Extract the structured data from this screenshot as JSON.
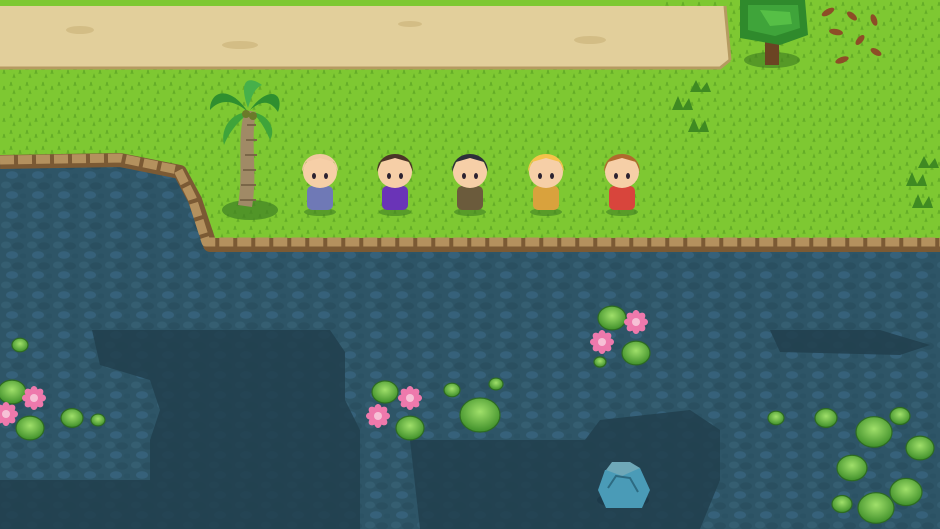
{
  "scene": {
    "type": "top-down-rpg-map",
    "terrain": [
      "dirt-path",
      "grass",
      "rocky-shoreline",
      "lake",
      "deep-water"
    ],
    "colors": {
      "grass": "#7ec832",
      "grass_dark": "#5fa526",
      "path": "#e2cf9b",
      "path_edge": "#b59a61",
      "water": "#2e5567",
      "deep_water": "#203e4d",
      "rock": "#b4915e",
      "rock_dark": "#7b5a34",
      "lily_pad": "#6fbf3b",
      "lotus": "#ee79ac"
    }
  },
  "party": [
    {
      "id": "elder",
      "role": "bald old man in blue robe",
      "hair": "#f1c9a1",
      "outfit": "#6f79b6"
    },
    {
      "id": "noble",
      "role": "bearded man in purple coat",
      "hair": "#4b3528",
      "outfit": "#6a34b7"
    },
    {
      "id": "rogue",
      "role": "dark-haired warrior with goggles",
      "hair": "#2d2f3a",
      "outfit": "#6b5b3c"
    },
    {
      "id": "priestess",
      "role": "blonde girl with white bandana",
      "hair": "#f5c34a",
      "outfit": "#d9a23d"
    },
    {
      "id": "hero",
      "role": "brown-haired boy in red",
      "hair": "#b06a2e",
      "outfit": "#d8453c"
    }
  ],
  "objects": [
    "palm-tree",
    "oak-tree",
    "fallen-leaves",
    "grass-tufts",
    "lily-pads",
    "lotus-flowers",
    "water-stump"
  ]
}
